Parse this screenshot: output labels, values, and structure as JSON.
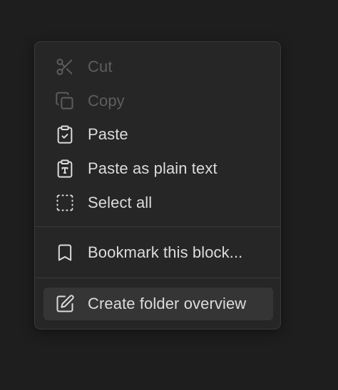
{
  "menu": {
    "items": [
      {
        "label": "Cut",
        "icon": "scissors-icon",
        "disabled": true
      },
      {
        "label": "Copy",
        "icon": "copy-icon",
        "disabled": true
      },
      {
        "label": "Paste",
        "icon": "clipboard-check-icon",
        "disabled": false
      },
      {
        "label": "Paste as plain text",
        "icon": "clipboard-type-icon",
        "disabled": false
      },
      {
        "label": "Select all",
        "icon": "dashed-square-icon",
        "disabled": false
      },
      {
        "label": "Bookmark this block...",
        "icon": "bookmark-icon",
        "disabled": false
      },
      {
        "label": "Create folder overview",
        "icon": "pen-square-icon",
        "disabled": false,
        "highlighted": true
      }
    ]
  },
  "colors": {
    "background": "#1e1e1e",
    "menu_bg": "#262626",
    "menu_border": "#3a3a3a",
    "text": "#dcdcdc",
    "disabled_text": "#5e5e5e",
    "highlight": "#353535"
  }
}
